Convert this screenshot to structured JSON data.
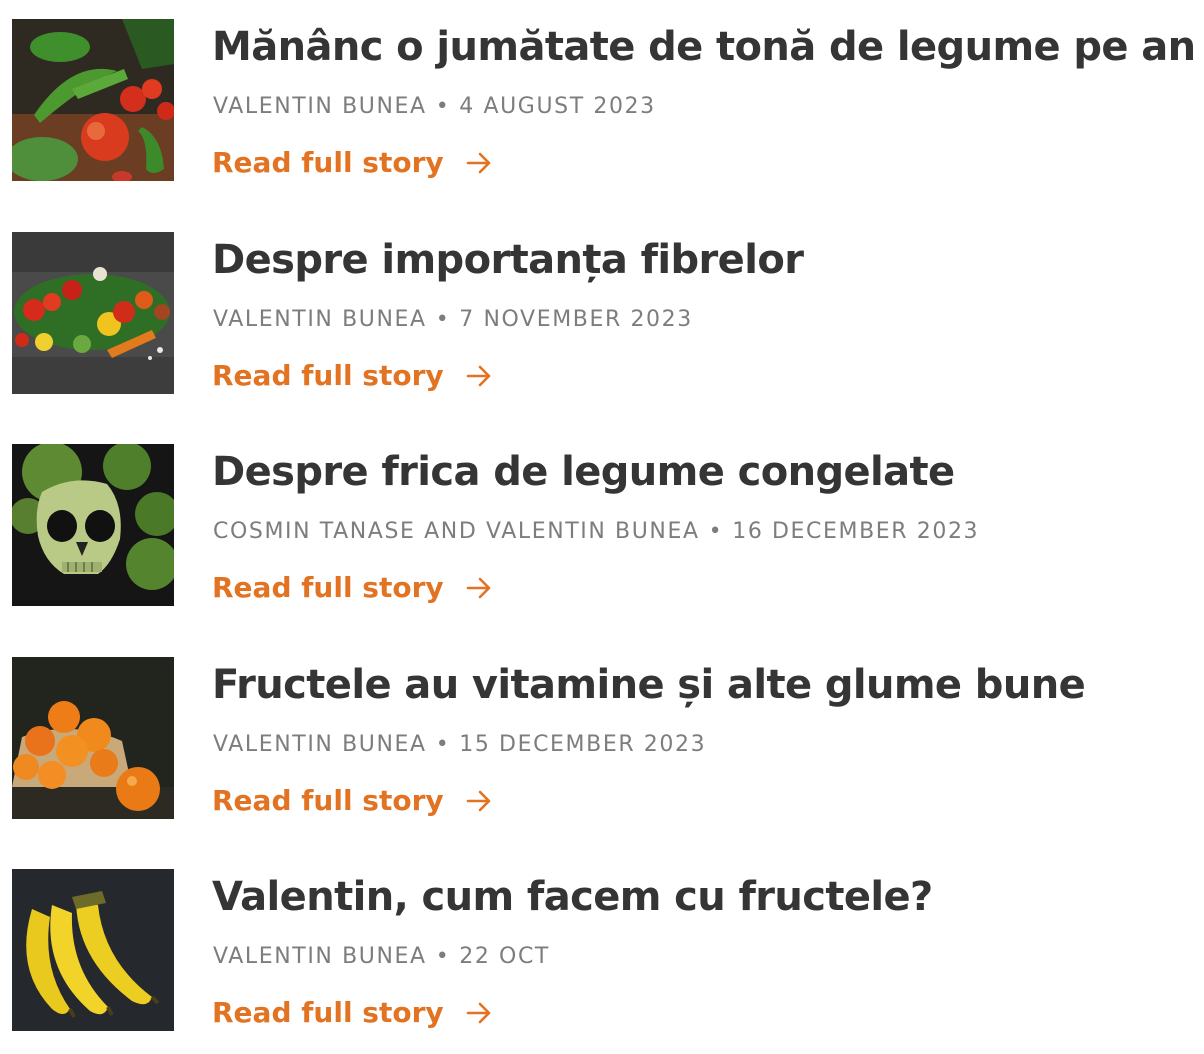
{
  "stories": [
    {
      "title": "Mănânc o jumătate de tonă de legume pe an",
      "author": "VALENTIN BUNEA",
      "date": "4 AUGUST 2023",
      "link_label": "Read full story",
      "thumbnail_icon": "vegetables-photo"
    },
    {
      "title": "Despre importanța fibrelor",
      "author": "VALENTIN BUNEA",
      "date": "7 NOVEMBER 2023",
      "link_label": "Read full story",
      "thumbnail_icon": "vegetables-photo"
    },
    {
      "title": "Despre frica de legume congelate",
      "author": "COSMIN TANASE AND VALENTIN BUNEA",
      "date": "16 DECEMBER 2023",
      "link_label": "Read full story",
      "thumbnail_icon": "broccoli-skull-photo"
    },
    {
      "title": "Fructele au vitamine și alte glume bune",
      "author": "VALENTIN BUNEA",
      "date": "15 DECEMBER 2023",
      "link_label": "Read full story",
      "thumbnail_icon": "oranges-photo"
    },
    {
      "title": "Valentin, cum facem cu fructele?",
      "author": "VALENTIN BUNEA",
      "date": "22 OCT",
      "link_label": "Read full story",
      "thumbnail_icon": "bananas-photo"
    }
  ],
  "meta_separator": "•",
  "colors": {
    "title": "#353535",
    "meta": "#7d7d7d",
    "link": "#e27322"
  }
}
